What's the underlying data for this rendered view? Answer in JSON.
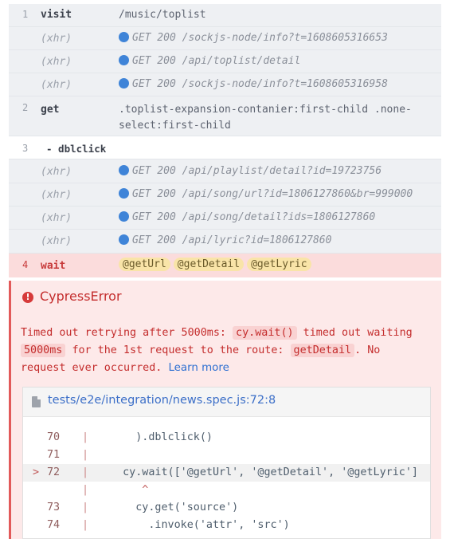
{
  "command_log": [
    {
      "num": "1",
      "name": "visit",
      "message": "/music/toplist"
    },
    {
      "xhr": "(xhr)",
      "message": "GET 200 /sockjs-node/info?t=1608605316653"
    },
    {
      "xhr": "(xhr)",
      "message": "GET 200 /api/toplist/detail"
    },
    {
      "xhr": "(xhr)",
      "message": "GET 200 /sockjs-node/info?t=1608605316958"
    },
    {
      "num": "2",
      "name": "get",
      "message_line1": ".toplist-expansion-contanier:first-child .none-",
      "message_line2": "select:first-child"
    },
    {
      "num": "3",
      "name": "- dblclick"
    },
    {
      "xhr": "(xhr)",
      "message": "GET 200 /api/playlist/detail?id=19723756"
    },
    {
      "xhr": "(xhr)",
      "message": "GET 200 /api/song/url?id=1806127860&br=999000"
    },
    {
      "xhr": "(xhr)",
      "message": "GET 200 /api/song/detail?ids=1806127860"
    },
    {
      "xhr": "(xhr)",
      "message": "GET 200 /api/lyric?id=1806127860"
    },
    {
      "num": "4",
      "name": "wait",
      "aliases": [
        "@getUrl",
        "@getDetail",
        "@getLyric"
      ]
    }
  ],
  "error": {
    "icon": "error-icon",
    "title": "CypressError",
    "msg_part1": "Timed out retrying after 5000ms:",
    "code1": "cy.wait()",
    "msg_part2": "timed out waiting",
    "code2": "5000ms",
    "msg_part3": "for the 1st request to the route:",
    "code3": "getDetail",
    "msg_part4": ". No",
    "msg_part5": "request ever occurred.",
    "learn_more": "Learn more",
    "file_link": "tests/e2e/integration/news.spec.js:72:8",
    "code_lines": [
      {
        "lno": "70",
        "src": "    ).dblclick()"
      },
      {
        "lno": "71",
        "src": ""
      },
      {
        "lno": "72",
        "src": "  cy.wait(['@getUrl', '@getDetail', '@getLyric']",
        "arrow": ">"
      },
      {
        "lno": "",
        "src": "     ^"
      },
      {
        "lno": "73",
        "src": "    cy.get('source')"
      },
      {
        "lno": "74",
        "src": "      .invoke('attr', 'src')"
      }
    ]
  }
}
